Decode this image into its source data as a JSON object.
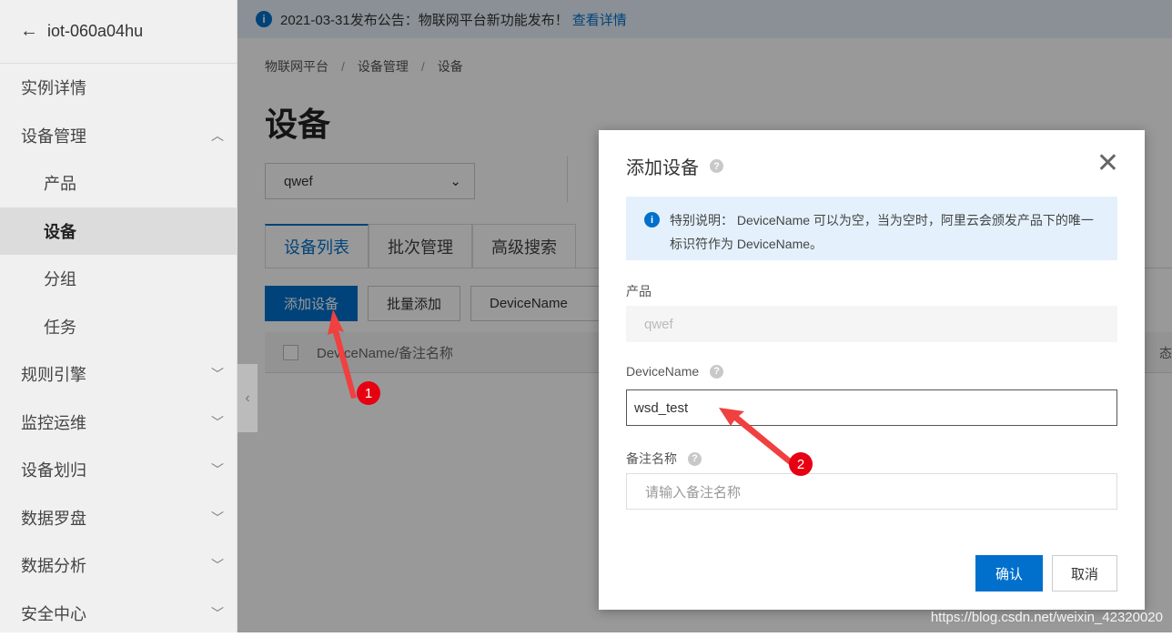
{
  "sidebar": {
    "instance": "iot-060a04hu",
    "items": [
      {
        "label": "实例详情",
        "expandable": false
      },
      {
        "label": "设备管理",
        "expandable": true,
        "expanded": true
      },
      {
        "label": "产品",
        "sub": true
      },
      {
        "label": "设备",
        "sub": true,
        "active": true
      },
      {
        "label": "分组",
        "sub": true
      },
      {
        "label": "任务",
        "sub": true
      },
      {
        "label": "规则引擎",
        "expandable": true
      },
      {
        "label": "监控运维",
        "expandable": true
      },
      {
        "label": "设备划归",
        "expandable": true
      },
      {
        "label": "数据罗盘",
        "expandable": true
      },
      {
        "label": "数据分析",
        "expandable": true
      },
      {
        "label": "安全中心",
        "expandable": true
      }
    ]
  },
  "banner": {
    "text": "2021-03-31发布公告：物联网平台新功能发布！",
    "link": "查看详情"
  },
  "breadcrumb": [
    "物联网平台",
    "设备管理",
    "设备"
  ],
  "page_title": "设备",
  "product_select": "qwef",
  "tabs": [
    "设备列表",
    "批次管理",
    "高级搜索"
  ],
  "toolbar": {
    "add": "添加设备",
    "batch_add": "批量添加",
    "filter": "DeviceName"
  },
  "table": {
    "col1": "DeviceName/备注名称",
    "status": "态"
  },
  "modal": {
    "title": "添加设备",
    "note": "特别说明： DeviceName 可以为空，当为空时，阿里云会颁发产品下的唯一标识符作为 DeviceName。",
    "product_label": "产品",
    "product_value": "qwef",
    "devicename_label": "DeviceName",
    "devicename_value": "wsd_test",
    "alias_label": "备注名称",
    "alias_placeholder": "请输入备注名称",
    "confirm": "确认",
    "cancel": "取消"
  },
  "annotations": [
    "1",
    "2"
  ],
  "watermark": "https://blog.csdn.net/weixin_42320020",
  "colors": {
    "primary": "#0070cc",
    "annotation": "#e60012"
  }
}
